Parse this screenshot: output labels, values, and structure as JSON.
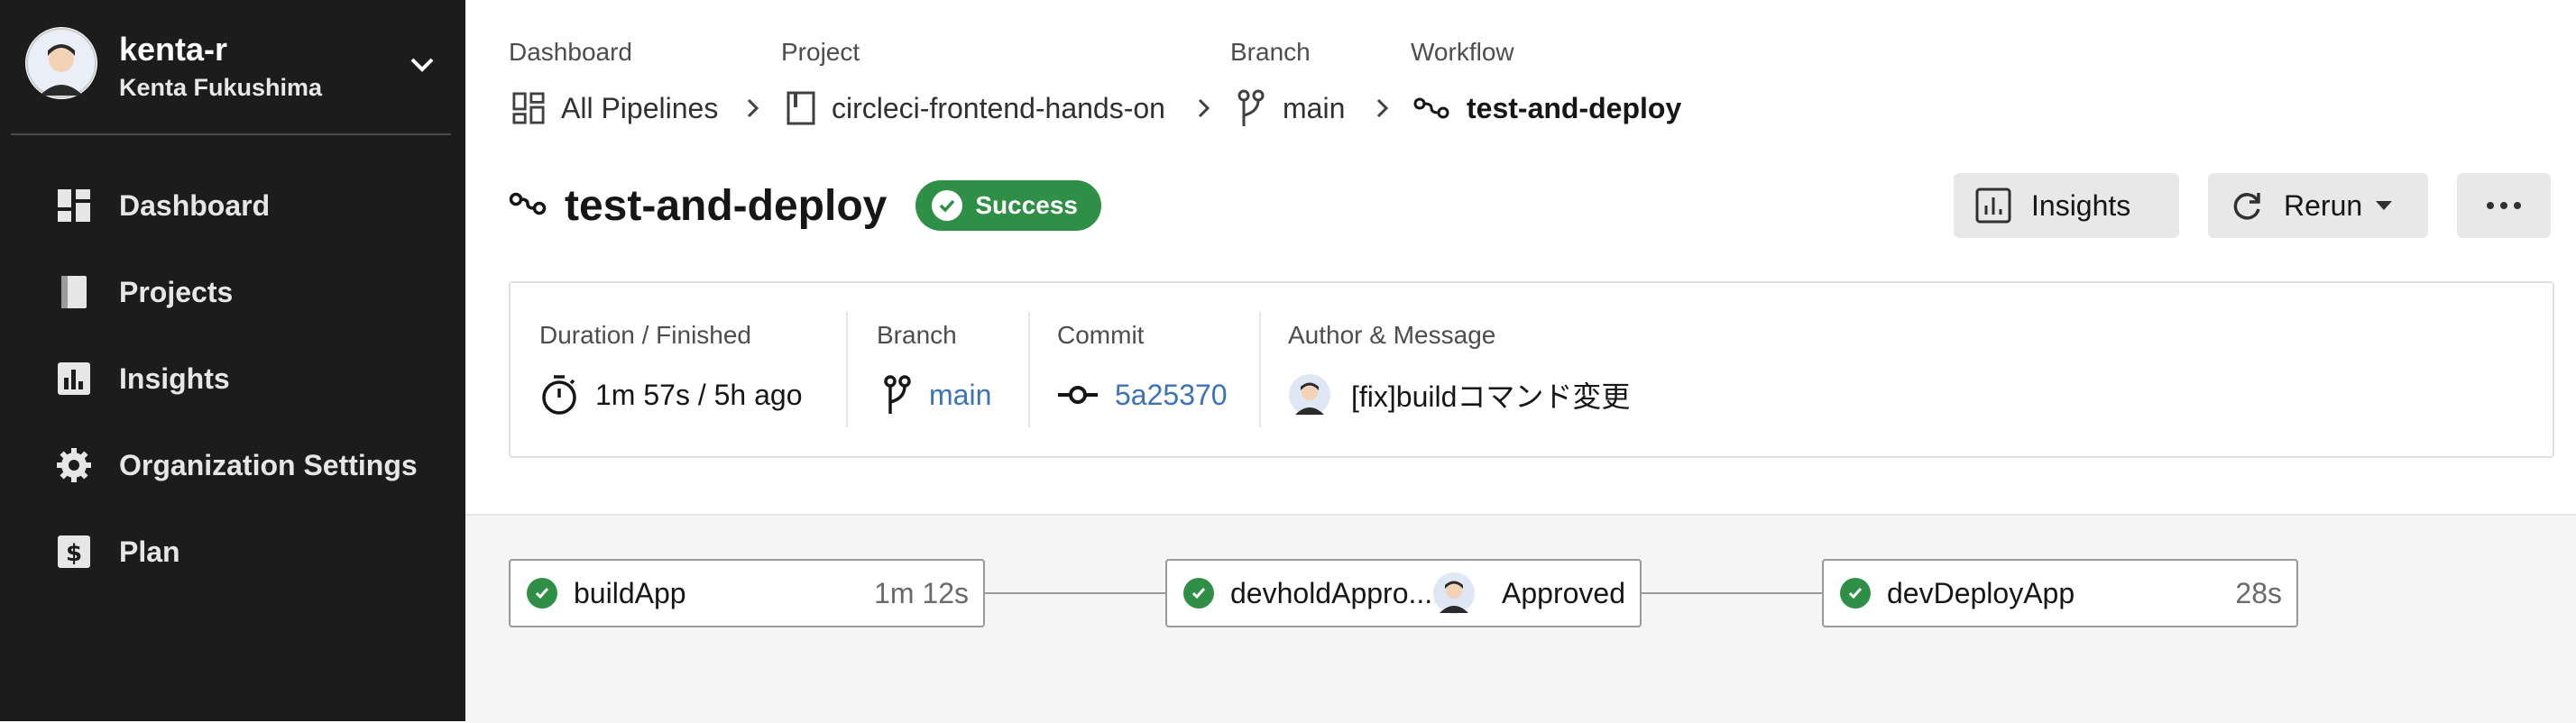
{
  "user": {
    "username": "kenta-r",
    "full_name": "Kenta Fukushima"
  },
  "sidebar": {
    "items": [
      {
        "label": "Dashboard",
        "icon": "dashboard-icon"
      },
      {
        "label": "Projects",
        "icon": "book-icon"
      },
      {
        "label": "Insights",
        "icon": "bar-chart-icon"
      },
      {
        "label": "Organization Settings",
        "icon": "gear-icon"
      },
      {
        "label": "Plan",
        "icon": "dollar-icon"
      }
    ]
  },
  "breadcrumb": {
    "labels": [
      "Dashboard",
      "Project",
      "Branch",
      "Workflow"
    ],
    "values": [
      "All Pipelines",
      "circleci-frontend-hands-on",
      "main",
      "test-and-deploy"
    ]
  },
  "workflow": {
    "title": "test-and-deploy",
    "status": "Success",
    "status_color": "#2f8f46"
  },
  "buttons": {
    "insights": "Insights",
    "rerun": "Rerun"
  },
  "summary": {
    "duration_label": "Duration / Finished",
    "duration_value": "1m 57s / 5h ago",
    "branch_label": "Branch",
    "branch_value": "main",
    "commit_label": "Commit",
    "commit_value": "5a25370",
    "author_label": "Author & Message",
    "message": "[fix]buildコマンド変更",
    "link_color": "#3a73b6"
  },
  "jobs": [
    {
      "name": "buildApp",
      "detail": "1m 12s"
    },
    {
      "name": "devholdAppro...",
      "detail": "Approved"
    },
    {
      "name": "devDeployApp",
      "detail": "28s"
    }
  ]
}
